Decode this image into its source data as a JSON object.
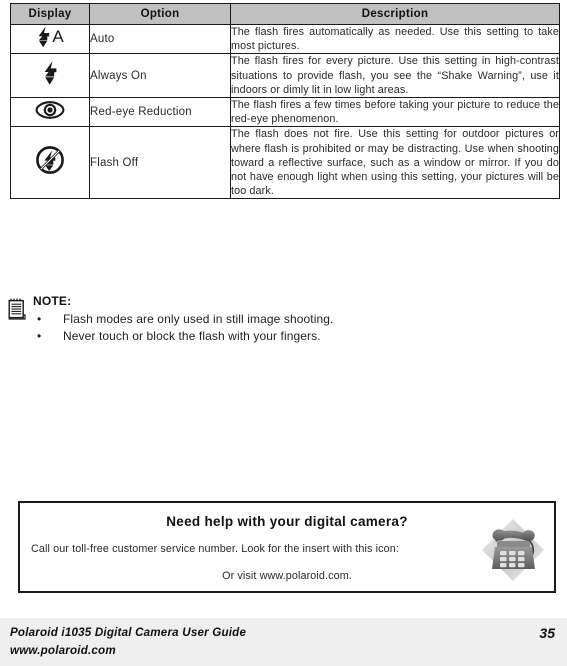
{
  "table": {
    "headers": [
      "Display",
      "Option",
      "Description"
    ],
    "rows": [
      {
        "icon": "flash-auto-icon",
        "icon_letter": "A",
        "option": "Auto",
        "description": "The flash fires automatically as needed. Use this setting to take most pictures."
      },
      {
        "icon": "flash-always-on-icon",
        "icon_letter": "",
        "option": "Always On",
        "description": "The flash fires for every picture. Use this setting in high-contrast situations to provide flash, you see the “Shake Warning”, use it indoors or dimly lit in low light areas."
      },
      {
        "icon": "red-eye-reduction-icon",
        "icon_letter": "",
        "option": "Red-eye Reduction",
        "description": "The flash fires a few times before taking your picture to reduce the red-eye phenomenon."
      },
      {
        "icon": "flash-off-icon",
        "icon_letter": "",
        "option": "Flash Off",
        "description": "The flash does not fire. Use this setting for outdoor pictures or where flash is prohibited or may be distracting. Use when shooting toward a reflective surface, such as a window or mirror. If you do not have enough light when using this setting, your pictures will be too dark."
      }
    ]
  },
  "note": {
    "icon": "notepad-icon",
    "title": "NOTE:",
    "bullet": "•",
    "items": [
      "Flash modes are only used in still image shooting.",
      "Never touch or block the flash with your fingers."
    ]
  },
  "help": {
    "title": "Need help with your digital camera?",
    "line1": "Call our toll-free customer service number. Look for the insert with this icon:",
    "line2": "Or visit www.polaroid.com.",
    "icon": "telephone-icon"
  },
  "footer": {
    "guide": "Polaroid i1035 Digital Camera User Guide",
    "url": "www.polaroid.com",
    "page": "35"
  },
  "colors": {
    "header_fill": "#c0c0c0",
    "ink": "#1a1a1a",
    "footer_fill": "#efefef"
  }
}
